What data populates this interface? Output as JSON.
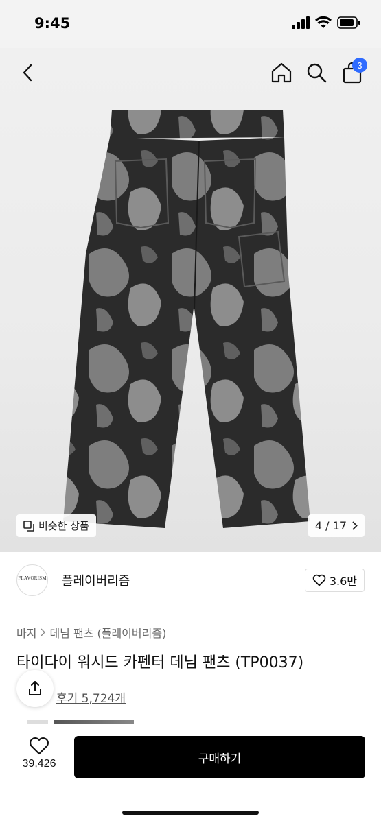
{
  "status_bar": {
    "time": "9:45"
  },
  "nav": {
    "cart_count": "3"
  },
  "gallery": {
    "similar_label": "비슷한 상품",
    "page_indicator": "4 / 17"
  },
  "brand": {
    "logo_text": "FLAVORISM",
    "name": "플레이버리즘",
    "likes": "3.6만"
  },
  "breadcrumb": {
    "category": "바지",
    "sub_category": "데님 팬츠 (플레이버리즘)"
  },
  "product": {
    "title": "타이다이 워시드 카펜터 데님 팬츠 (TP0037)",
    "reviews": "후기 5,724개"
  },
  "bottom_bar": {
    "fav_count": "39,426",
    "buy_label": "구매하기"
  }
}
